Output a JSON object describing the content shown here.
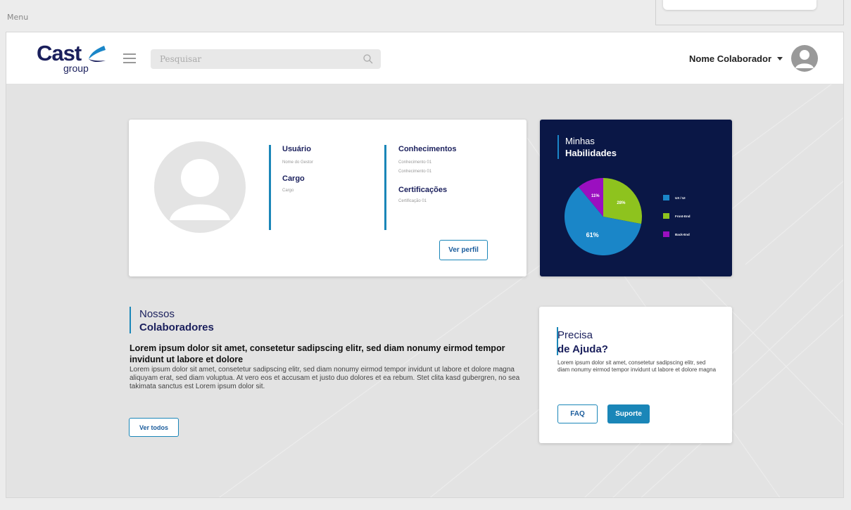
{
  "top": {
    "menu_label": "Menu"
  },
  "header": {
    "logo_text": "Cast",
    "logo_sub": "group",
    "search_placeholder": "Pesquisar",
    "user_name": "Nome Colaborador"
  },
  "profile": {
    "usuario_title": "Usuário",
    "usuario_value": "Nome do Gestor",
    "cargo_title": "Cargo",
    "cargo_value": "Cargo",
    "conhecimentos_title": "Conhecimentos",
    "conhecimentos": [
      "Conhecimento 01",
      "Conhecimento 01"
    ],
    "certificacoes_title": "Certificações",
    "certificacoes": [
      "Certificação 01"
    ],
    "ver_perfil_label": "Ver perfil"
  },
  "skills": {
    "title_line1": "Minhas",
    "title_line2": "Habilidades",
    "chart_data": {
      "type": "pie",
      "slices": [
        {
          "label": "UX / UI",
          "value": 61,
          "display": "61%",
          "color": "#1a86c8"
        },
        {
          "label": "Front-End",
          "value": 28,
          "display": "28%",
          "color": "#8ec31e"
        },
        {
          "label": "Back-End",
          "value": 11,
          "display": "11%",
          "color": "#9b0fc0"
        }
      ],
      "legend_position": "right"
    }
  },
  "colaboradores": {
    "title_line1": "Nossos",
    "title_line2": "Colaboradores",
    "lead": "Lorem ipsum dolor sit amet, consetetur sadipscing elitr, sed diam nonumy eirmod tempor invidunt ut labore et dolore",
    "body": "Lorem ipsum dolor sit amet, consetetur sadipscing elitr, sed diam nonumy eirmod tempor invidunt ut labore et dolore magna aliquyam erat, sed diam voluptua. At vero eos et accusam et justo duo dolores et ea rebum. Stet clita kasd gubergren, no sea takimata sanctus est Lorem ipsum dolor sit.",
    "ver_todos_label": "Ver todos"
  },
  "ajuda": {
    "title_line1": "Precisa",
    "title_line2": "de Ajuda?",
    "body": "Lorem ipsum dolor sit amet, consetetur sadipscing elitr, sed diam nonumy eirmod tempor invidunt ut labore et dolore magna",
    "faq_label": "FAQ",
    "suporte_label": "Suporte"
  }
}
